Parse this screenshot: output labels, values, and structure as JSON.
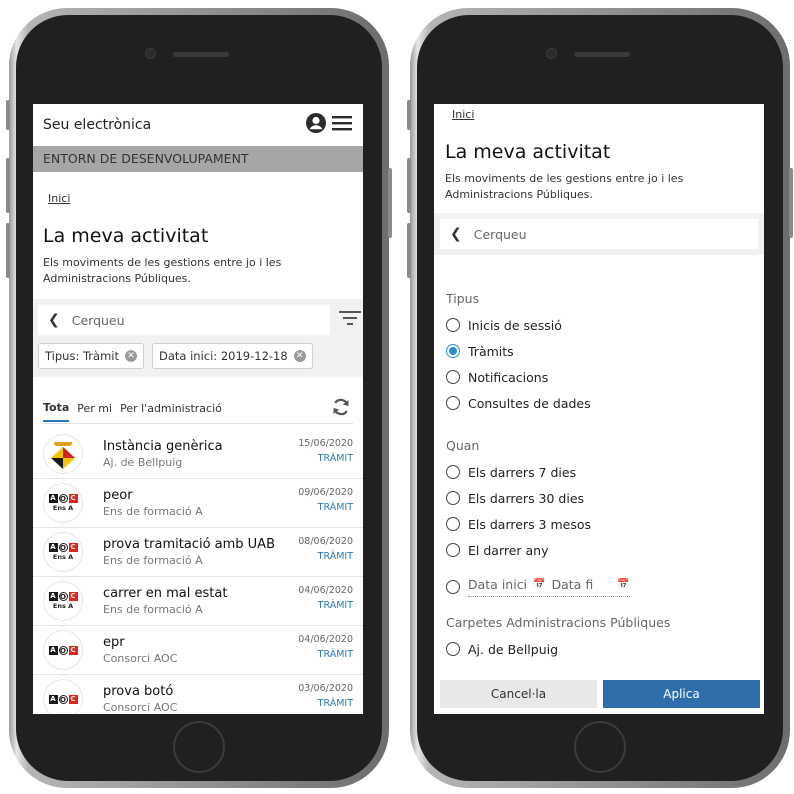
{
  "left": {
    "header": {
      "title": "Seu electrònica"
    },
    "env_banner": "ENTORN DE DESENVOLUPAMENT",
    "breadcrumb": "Inici",
    "page_title": "La meva activitat",
    "subtitle": "Els moviments de les gestions entre jo i les Administracions Públiques.",
    "search": {
      "placeholder": "Cerqueu"
    },
    "chips": [
      {
        "label": "Tipus: Tràmit"
      },
      {
        "label": "Data inici: 2019-12-18"
      }
    ],
    "tabs": [
      {
        "label": "Tota"
      },
      {
        "label": "Per mi"
      },
      {
        "label": "Per l'administració"
      }
    ],
    "items": [
      {
        "title": "Instància genèrica",
        "org": "Aj. de Bellpuig",
        "date": "15/06/2020",
        "type": "TRÀMIT",
        "logo": "coat-of-arms-icon"
      },
      {
        "title": "peor",
        "org": "Ens de formació A",
        "date": "09/06/2020",
        "type": "TRÀMIT",
        "logo": "aoc-ens-a-logo"
      },
      {
        "title": "prova tramitació amb UAB",
        "org": "Ens de formació A",
        "date": "08/06/2020",
        "type": "TRÀMIT",
        "logo": "aoc-ens-a-logo"
      },
      {
        "title": "carrer en mal estat",
        "org": "Ens de formació A",
        "date": "04/06/2020",
        "type": "TRÀMIT",
        "logo": "aoc-ens-a-logo"
      },
      {
        "title": "epr",
        "org": "Consorci AOC",
        "date": "04/06/2020",
        "type": "TRÀMIT",
        "logo": "aoc-logo"
      },
      {
        "title": "prova botó",
        "org": "Consorci AOC",
        "date": "03/06/2020",
        "type": "TRÀMIT",
        "logo": "aoc-logo"
      }
    ],
    "logo_text": {
      "a": "A",
      "o": "O",
      "c": "C",
      "ens": "Ens A"
    }
  },
  "right": {
    "breadcrumb": "Inici",
    "page_title": "La meva activitat",
    "subtitle": "Els moviments de les gestions entre jo i les Administracions Públiques.",
    "search": {
      "placeholder": "Cerqueu"
    },
    "tipus": {
      "label": "Tipus",
      "options": [
        "Inicis de sessió",
        "Tràmits",
        "Notificacions",
        "Consultes de dades"
      ],
      "selected": "Tràmits"
    },
    "quan": {
      "label": "Quan",
      "options": [
        "Els darrers 7 dies",
        "Els darrers 30 dies",
        "Els darrers 3 mesos",
        "El darrer any"
      ]
    },
    "dates": {
      "start_placeholder": "Data inici",
      "end_placeholder": "Data fi"
    },
    "carpetes": {
      "label": "Carpetes Administracions Públiques",
      "options": [
        "Aj. de Bellpuig"
      ]
    },
    "buttons": {
      "cancel": "Cancel·la",
      "apply": "Aplica"
    }
  },
  "colors": {
    "accent": "#2a8fd8",
    "apply_button": "#2e6fab",
    "env_banner_bg": "#a6a6a6",
    "aoc_red": "#e2231a"
  }
}
